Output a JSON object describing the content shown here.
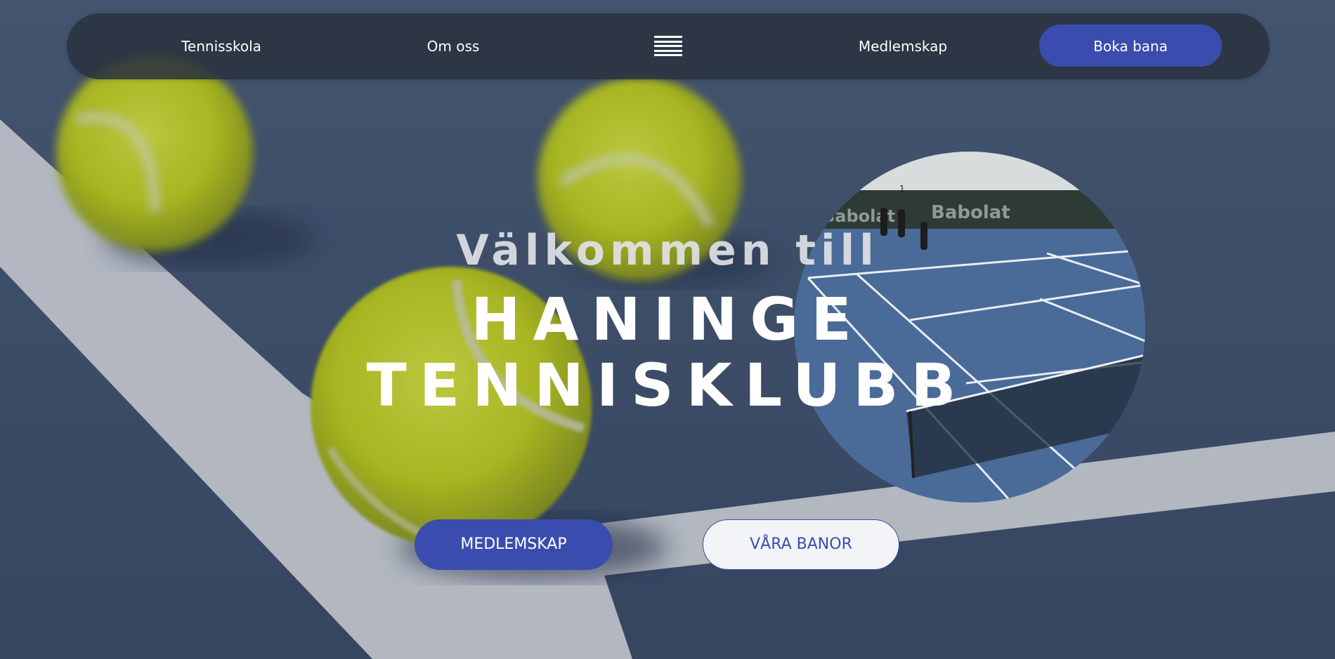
{
  "nav": {
    "links": [
      "Tennisskola",
      "Om oss",
      "Medlemskap"
    ],
    "menu_icon": "hamburger-menu-icon",
    "book_label": "Boka bana"
  },
  "hero": {
    "welcome": "Välkommen till",
    "title_line1": "HANINGE",
    "title_line2": "TENNISKLUBB",
    "background_image": "tennis-balls-court-photo",
    "court_photo": "indoor-tennis-court-photo",
    "court_number": "1",
    "court_banner": "Babolat"
  },
  "buttons": {
    "primary": "MEDLEMSKAP",
    "secondary": "VÅRA BANOR"
  },
  "colors": {
    "accent": "#3a4dae",
    "nav_bg": "#2a3240",
    "court": "#44536d",
    "ball": "#c6d41a"
  }
}
